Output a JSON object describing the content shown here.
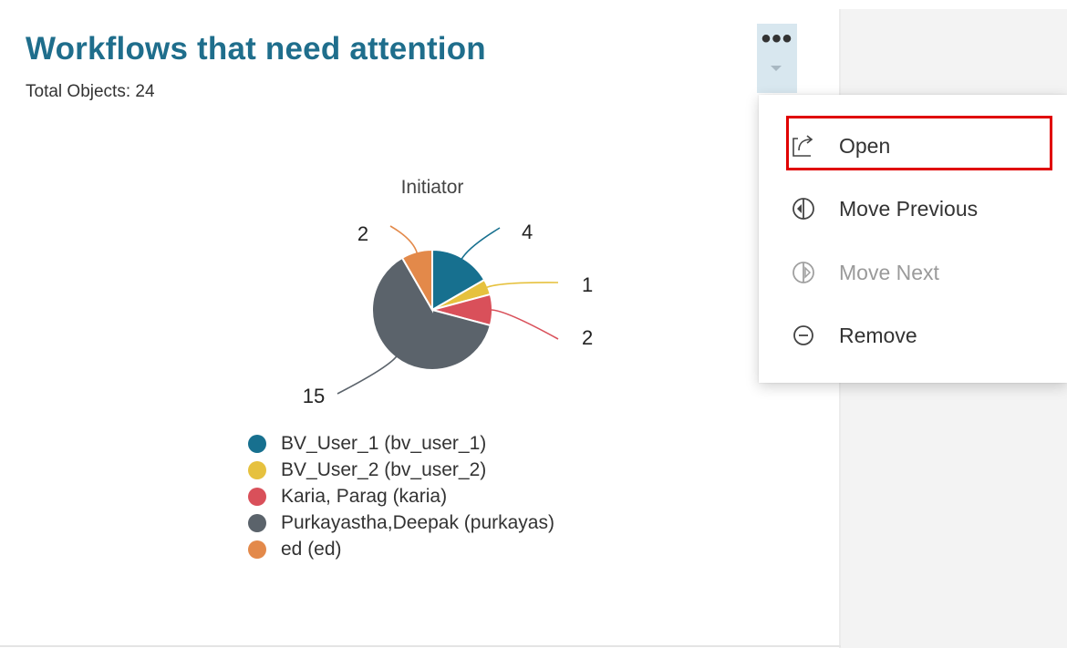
{
  "widget": {
    "title": "Workflows that need attention",
    "total_label": "Total Objects:",
    "total_value": "24"
  },
  "menu_trigger": {
    "dots": "•••",
    "icon": "ellipsis-icon"
  },
  "menu": {
    "items": [
      {
        "label": "Open",
        "icon": "open-external-icon",
        "disabled": false
      },
      {
        "label": "Move Previous",
        "icon": "move-previous-icon",
        "disabled": false
      },
      {
        "label": "Move Next",
        "icon": "move-next-icon",
        "disabled": true
      },
      {
        "label": "Remove",
        "icon": "remove-icon",
        "disabled": false
      }
    ],
    "highlight_color": "#e00000"
  },
  "chart_data": {
    "type": "pie",
    "title": "Initiator",
    "slices": [
      {
        "label": "BV_User_1 (bv_user_1)",
        "value": 4,
        "color": "#17708f"
      },
      {
        "label": "BV_User_2 (bv_user_2)",
        "value": 1,
        "color": "#e6c13e"
      },
      {
        "label": "Karia, Parag (karia)",
        "value": 2,
        "color": "#d9505a"
      },
      {
        "label": "Purkayastha,Deepak (purkayas)",
        "value": 15,
        "color": "#5b636b"
      },
      {
        "label": "ed (ed)",
        "value": 2,
        "color": "#e3894a"
      }
    ],
    "legend_position": "bottom"
  }
}
